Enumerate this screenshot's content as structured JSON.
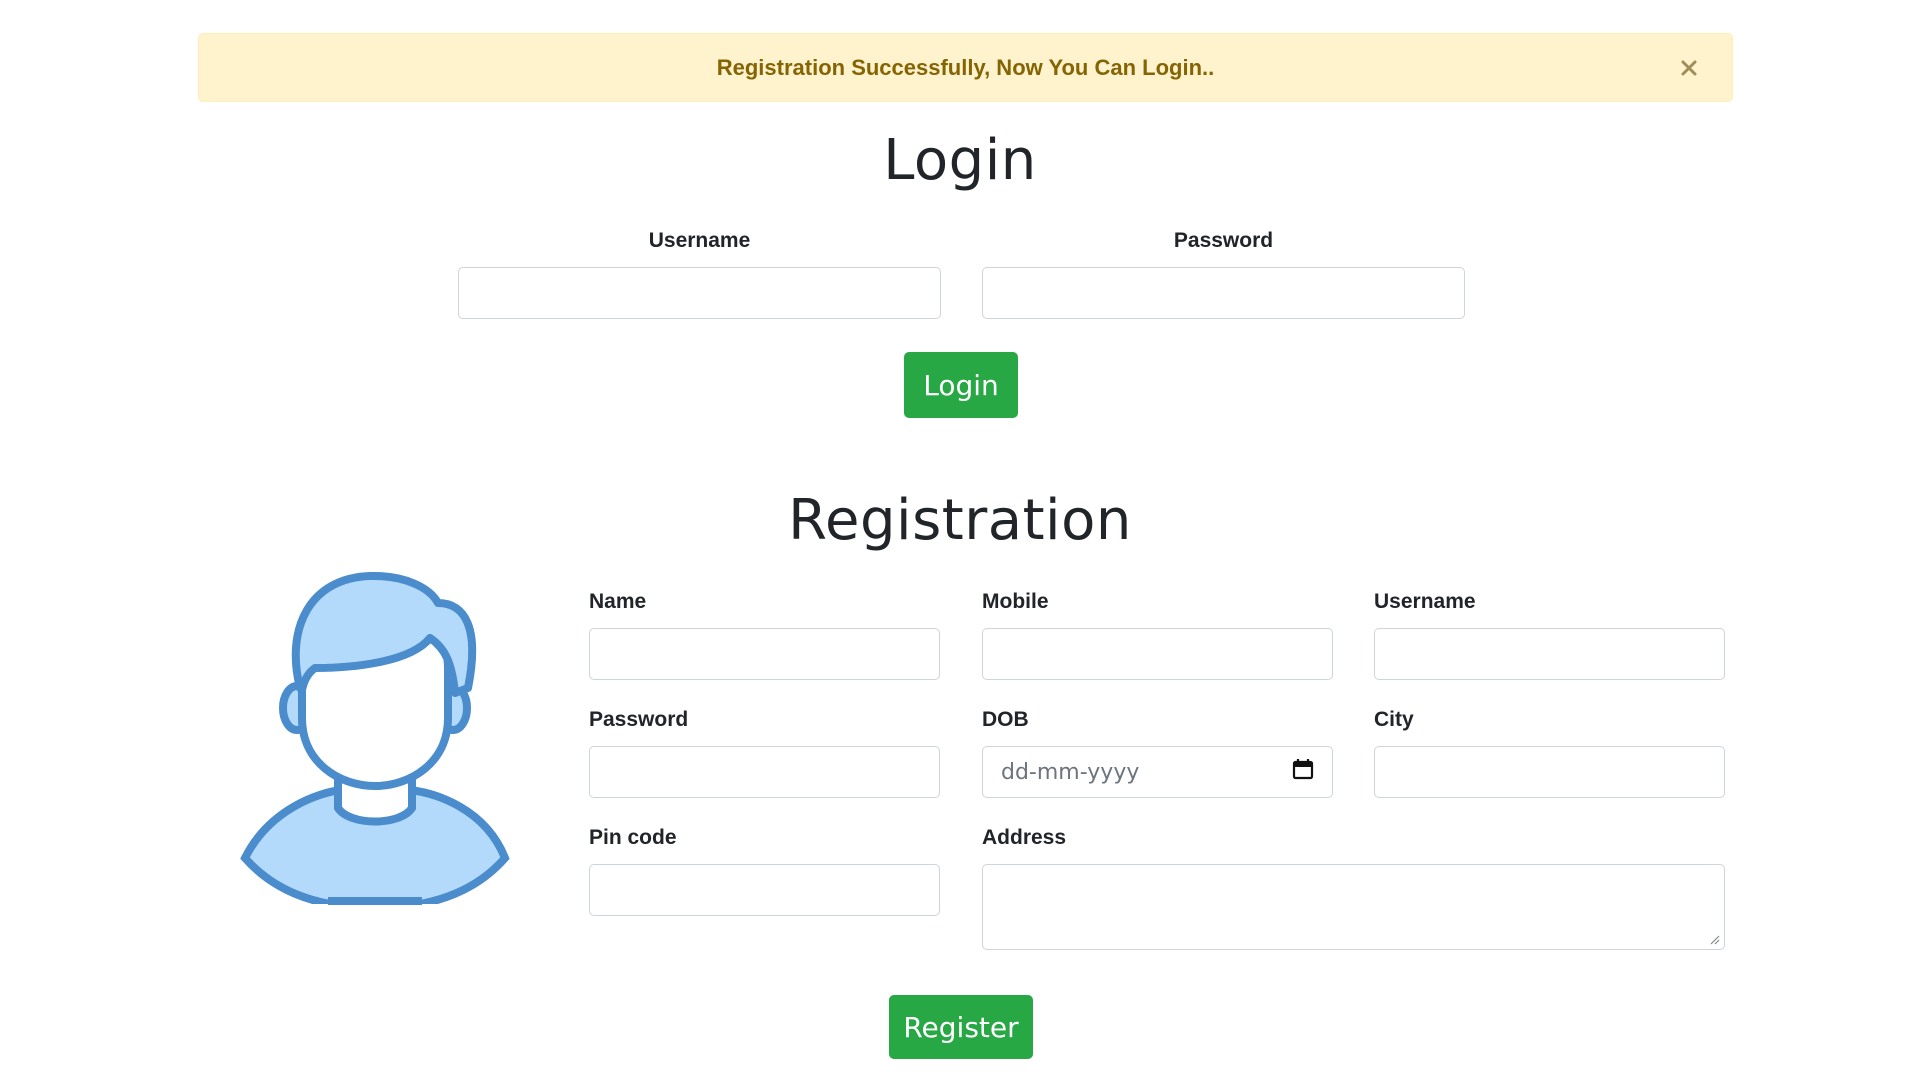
{
  "alert": {
    "message": "Registration Successfully, Now You Can Login..",
    "close_icon": "close-icon"
  },
  "login": {
    "title": "Login",
    "username_label": "Username",
    "password_label": "Password",
    "username_value": "",
    "password_value": "",
    "button_label": "Login"
  },
  "registration": {
    "title": "Registration",
    "avatar_icon": "user-avatar-icon",
    "fields": {
      "name_label": "Name",
      "mobile_label": "Mobile",
      "username_label": "Username",
      "password_label": "Password",
      "dob_label": "DOB",
      "dob_placeholder": "dd-mm-yyyy",
      "city_label": "City",
      "pincode_label": "Pin code",
      "address_label": "Address"
    },
    "button_label": "Register"
  },
  "colors": {
    "alert_bg": "#fff3cd",
    "alert_text": "#856404",
    "success": "#28a745",
    "avatar_stroke": "#4a8ccc",
    "avatar_fill": "#b3d9fb"
  }
}
